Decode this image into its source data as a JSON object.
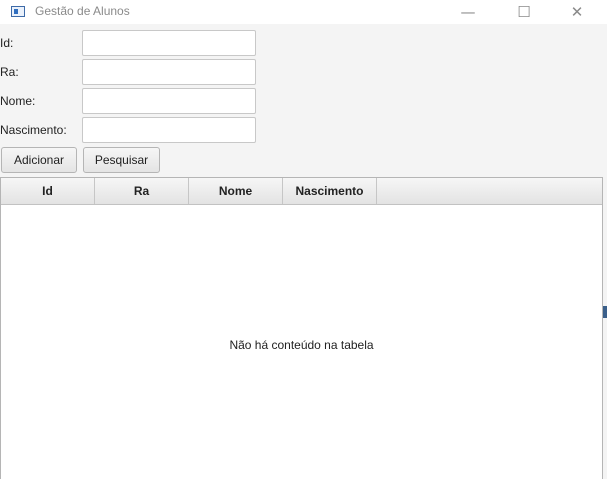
{
  "window": {
    "title": "Gestão de Alunos",
    "controls": {
      "minimize": "—",
      "maximize": "☐",
      "close": "✕"
    }
  },
  "form": {
    "fields": [
      {
        "label": "Id:",
        "value": ""
      },
      {
        "label": "Ra:",
        "value": ""
      },
      {
        "label": "Nome:",
        "value": ""
      },
      {
        "label": "Nascimento:",
        "value": ""
      }
    ]
  },
  "buttons": {
    "add_label": "Adicionar",
    "search_label": "Pesquisar"
  },
  "table": {
    "columns": [
      "Id",
      "Ra",
      "Nome",
      "Nascimento"
    ],
    "rows": [],
    "empty_message": "Não há conteúdo na tabela"
  }
}
